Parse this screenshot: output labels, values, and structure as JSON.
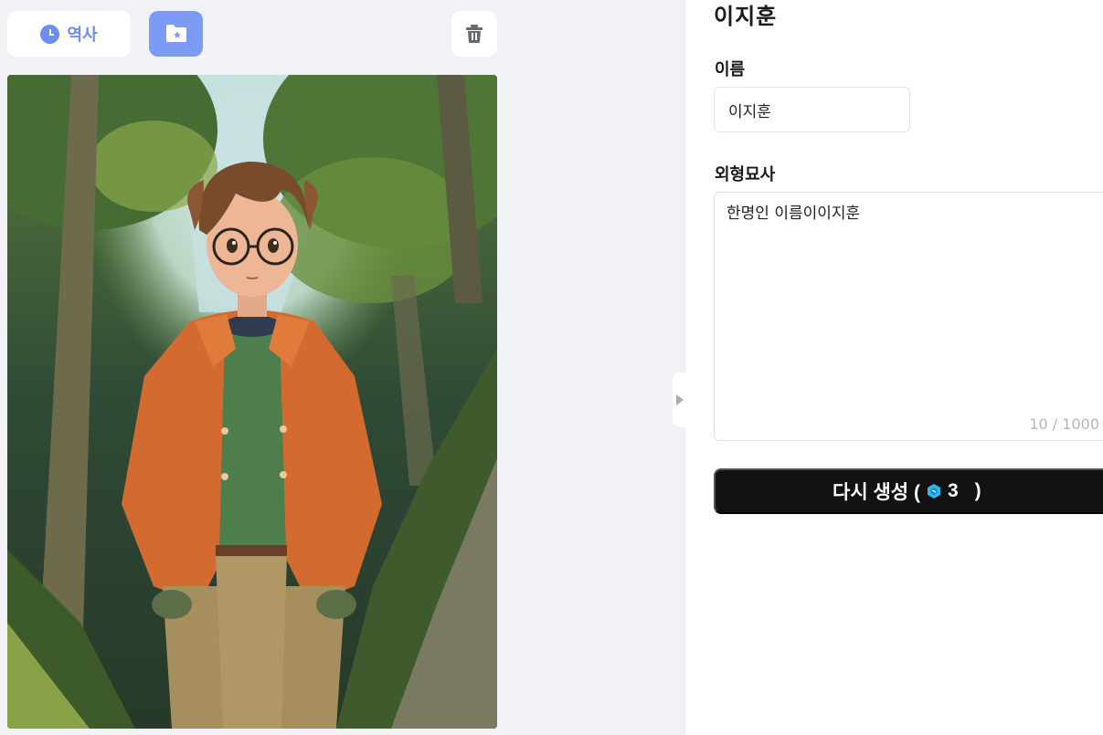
{
  "toolbar": {
    "history_label": "역사",
    "history_icon": "clock-icon",
    "folder_icon": "folder-star-icon",
    "trash_icon": "trash-icon",
    "accent_color": "#6b8ef0"
  },
  "character": {
    "title": "이지훈",
    "name_label": "이름",
    "name_value": "이지훈",
    "description_label": "외형묘사",
    "description_value": "한명인 이름이이지훈",
    "char_count": "10 / 1000"
  },
  "regenerate": {
    "label": "다시 생성 (",
    "cost": "3",
    "close": ")",
    "icon": "gem-icon"
  }
}
